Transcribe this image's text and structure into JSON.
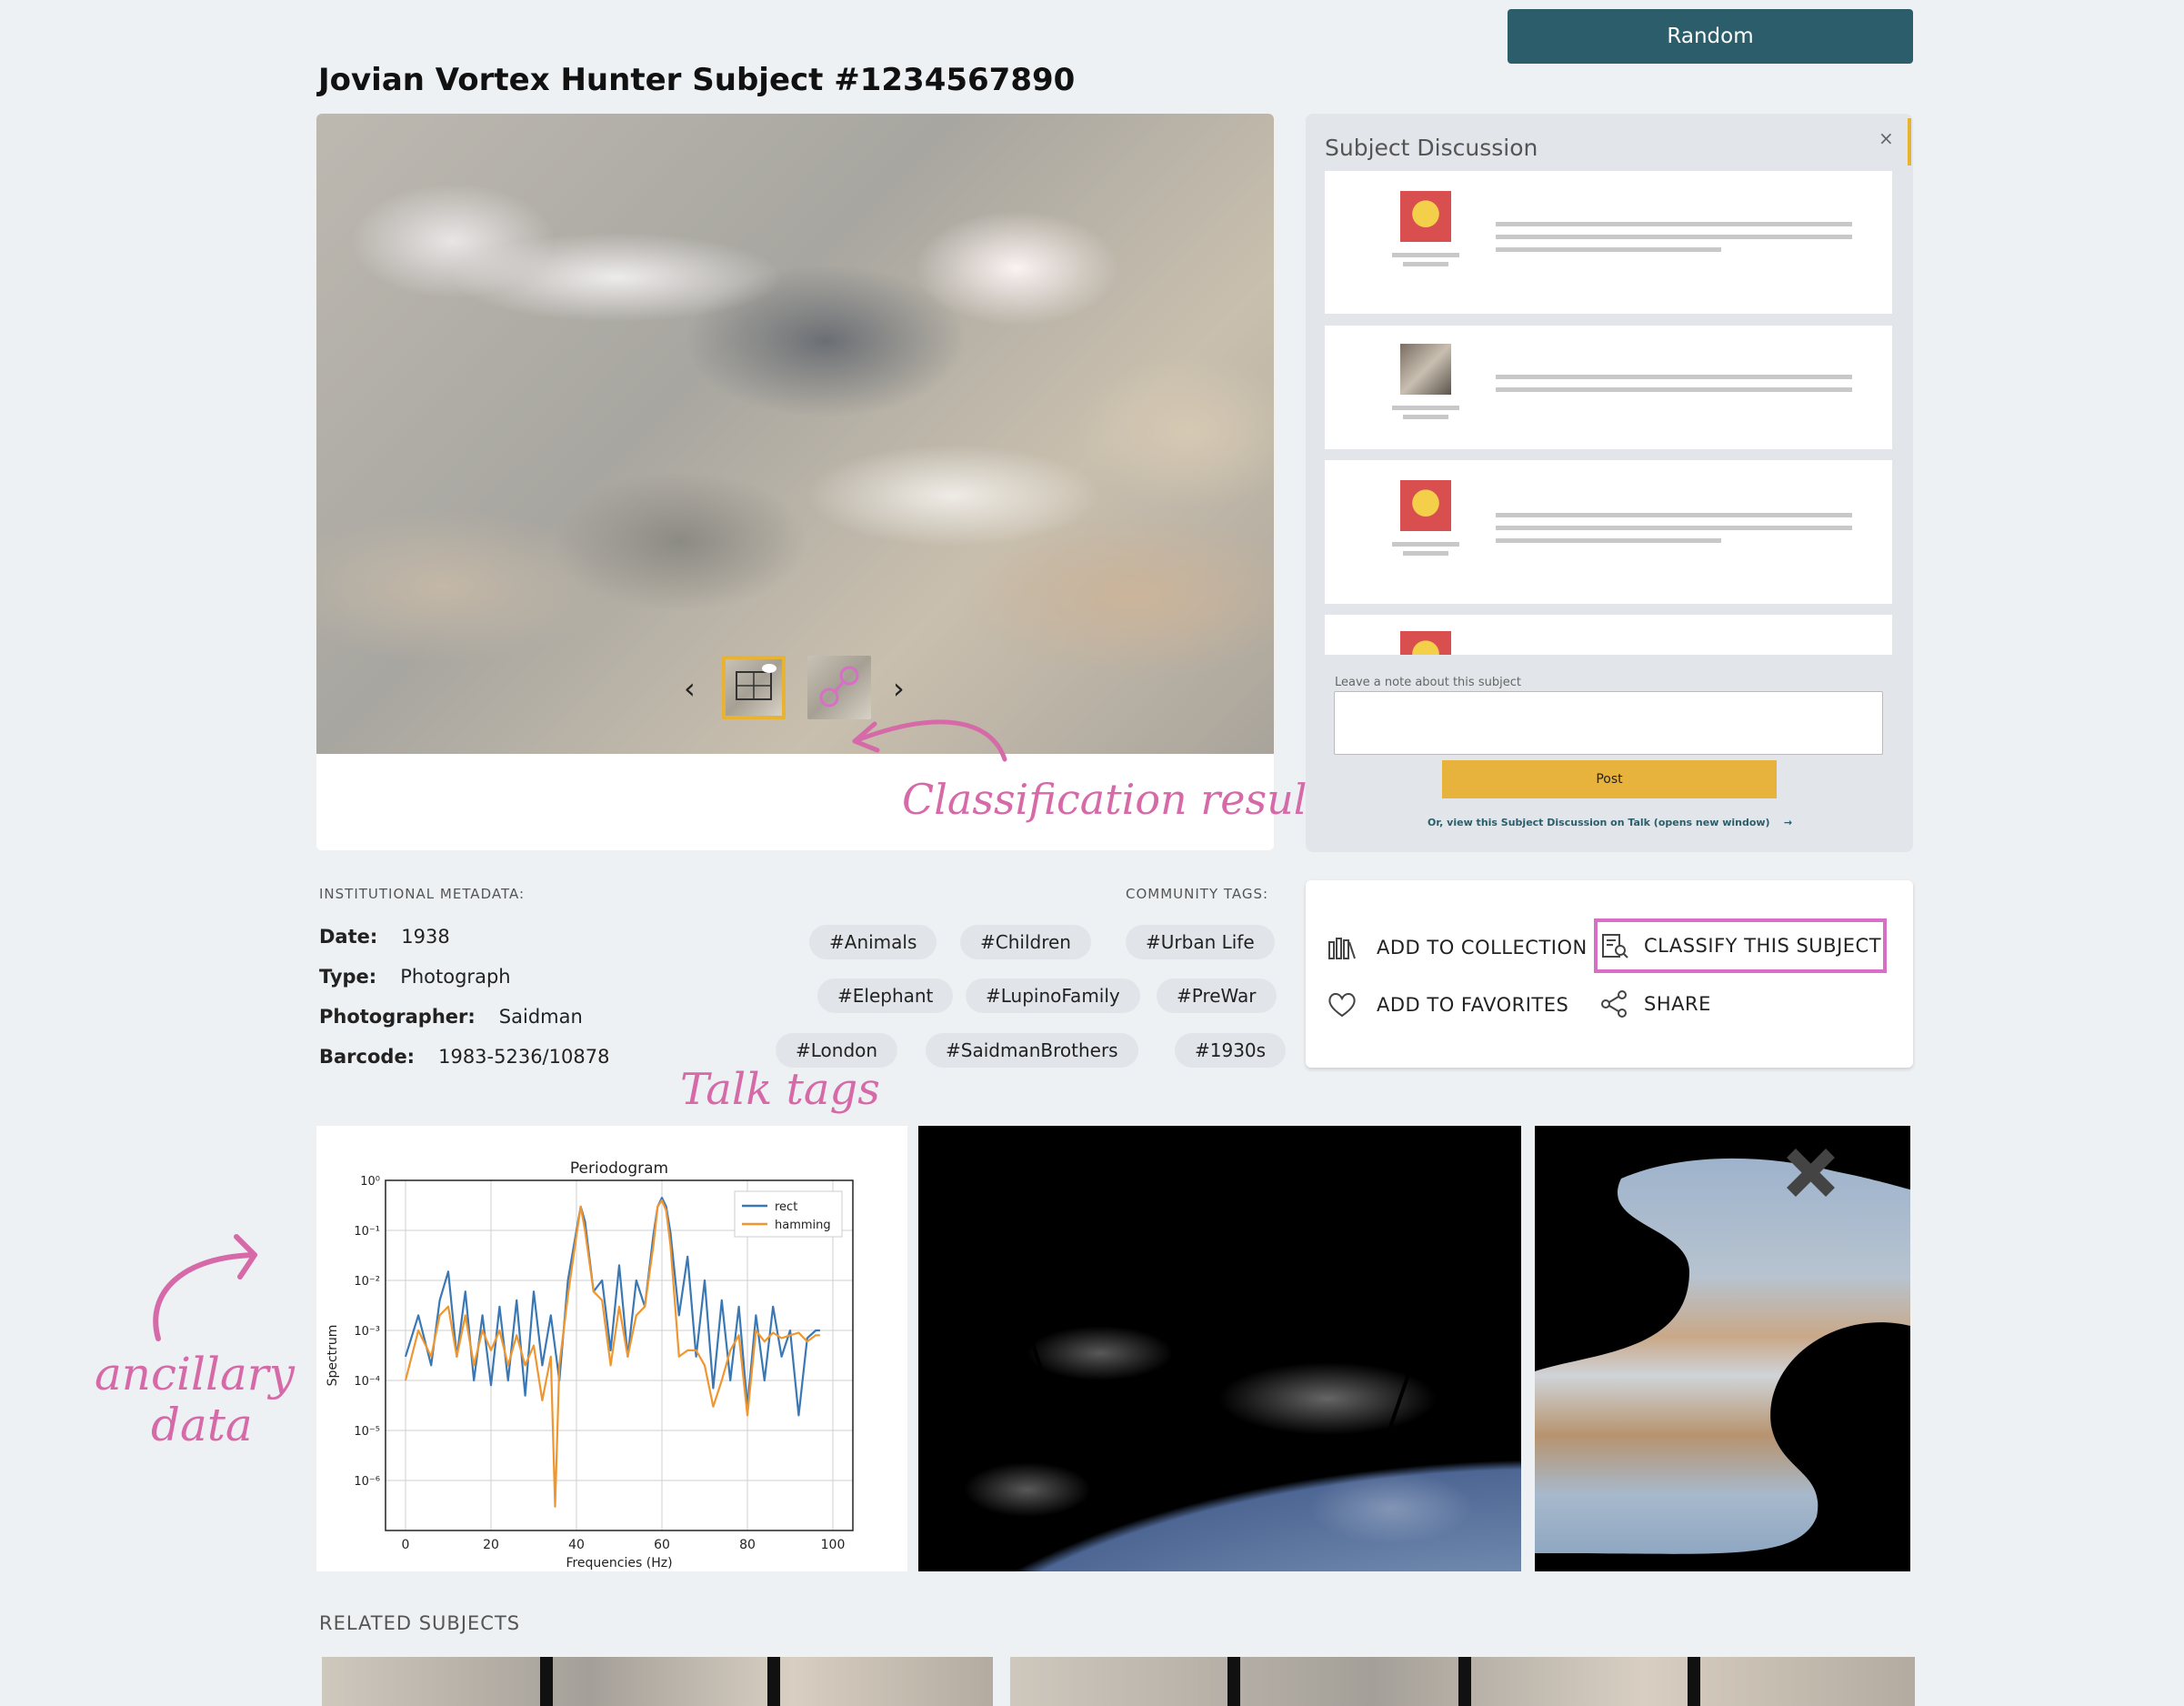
{
  "header": {
    "random_label": "Random",
    "title": "Jovian Vortex Hunter Subject #1234567890"
  },
  "viewer": {
    "prev_label": "‹",
    "next_label": "›",
    "annotation_classification": "Classification result"
  },
  "discussion": {
    "title": "Subject Discussion",
    "close_label": "×",
    "note_label": "Leave a note about this subject",
    "post_label": "Post",
    "talk_link": "Or, view this Subject Discussion on Talk (opens new window)",
    "talk_arrow": "→"
  },
  "metadata": {
    "heading": "INSTITUTIONAL METADATA:",
    "rows": [
      {
        "label": "Date:",
        "value": "1938"
      },
      {
        "label": "Type:",
        "value": "Photograph"
      },
      {
        "label": "Photographer:",
        "value": "Saidman"
      },
      {
        "label": "Barcode:",
        "value": "1983-5236/10878"
      }
    ]
  },
  "tags": {
    "heading": "COMMUNITY TAGS:",
    "items": [
      "#Animals",
      "#Children",
      "#Urban Life",
      "#Elephant",
      "#LupinoFamily",
      "#PreWar",
      "#London",
      "#SaidmanBrothers",
      "#1930s"
    ],
    "annotation": "Talk tags"
  },
  "actions": {
    "add_collection": "ADD TO COLLECTION",
    "classify": "CLASSIFY THIS SUBJECT",
    "add_favorites": "ADD TO FAVORITES",
    "share": "SHARE"
  },
  "ancillary": {
    "annotation_line1": "ancillary",
    "annotation_line2": "data"
  },
  "chart_data": {
    "type": "line",
    "title": "Periodogram",
    "xlabel": "Frequencies (Hz)",
    "ylabel": "Spectrum",
    "y_scale": "log",
    "xlim": [
      0,
      100
    ],
    "ylim": [
      1e-07,
      1
    ],
    "x_ticks": [
      "0",
      "20",
      "40",
      "60",
      "80",
      "100"
    ],
    "y_ticks": [
      "10⁰",
      "10⁻¹",
      "10⁻²",
      "10⁻³",
      "10⁻⁴",
      "10⁻⁵",
      "10⁻⁶"
    ],
    "grid": true,
    "legend_position": "top-right",
    "series": [
      {
        "name": "rect",
        "color": "#3a78b5",
        "x": [
          0,
          3,
          6,
          8,
          10,
          12,
          14,
          16,
          18,
          20,
          22,
          24,
          26,
          28,
          30,
          32,
          34,
          36,
          38,
          40,
          41,
          42,
          44,
          46,
          48,
          50,
          52,
          54,
          56,
          58,
          59,
          60,
          61,
          62,
          64,
          66,
          68,
          70,
          72,
          74,
          76,
          78,
          80,
          82,
          84,
          86,
          88,
          90,
          92,
          94,
          96,
          97
        ],
        "y": [
          0.0003,
          0.002,
          0.0002,
          0.004,
          0.015,
          0.0003,
          0.006,
          0.0001,
          0.002,
          8e-05,
          0.003,
          0.0001,
          0.004,
          5e-05,
          0.006,
          0.0002,
          0.002,
          0.0001,
          0.01,
          0.1,
          0.3,
          0.15,
          0.006,
          0.01,
          0.0004,
          0.02,
          0.0003,
          0.01,
          0.003,
          0.08,
          0.3,
          0.45,
          0.3,
          0.09,
          0.002,
          0.03,
          0.0003,
          0.01,
          7e-05,
          0.004,
          0.0001,
          0.003,
          3e-05,
          0.002,
          0.0001,
          0.003,
          0.0003,
          0.001,
          2e-05,
          0.0007,
          0.001,
          0.001
        ]
      },
      {
        "name": "hamming",
        "color": "#f0962e",
        "x": [
          0,
          3,
          6,
          8,
          10,
          12,
          14,
          16,
          18,
          20,
          22,
          24,
          26,
          28,
          30,
          32,
          34,
          35,
          36,
          38,
          40,
          41,
          42,
          44,
          46,
          48,
          50,
          52,
          54,
          56,
          58,
          59,
          60,
          61,
          62,
          64,
          66,
          68,
          70,
          72,
          74,
          76,
          78,
          80,
          82,
          84,
          86,
          88,
          90,
          92,
          94,
          96,
          97
        ],
        "y": [
          0.0001,
          0.001,
          0.0003,
          0.002,
          0.003,
          0.0003,
          0.002,
          0.0002,
          0.001,
          0.0004,
          0.001,
          0.0002,
          0.0008,
          0.0002,
          0.0005,
          4e-05,
          0.0003,
          3e-07,
          0.0002,
          0.005,
          0.08,
          0.3,
          0.1,
          0.006,
          0.004,
          0.0002,
          0.003,
          0.0003,
          0.002,
          0.003,
          0.05,
          0.3,
          0.4,
          0.25,
          0.05,
          0.0003,
          0.0004,
          0.0004,
          0.0002,
          3e-05,
          0.0001,
          0.0004,
          0.0008,
          2e-05,
          0.001,
          0.0006,
          0.0009,
          0.0007,
          0.0008,
          0.0009,
          0.0006,
          0.0008,
          0.0008
        ]
      }
    ]
  }
}
